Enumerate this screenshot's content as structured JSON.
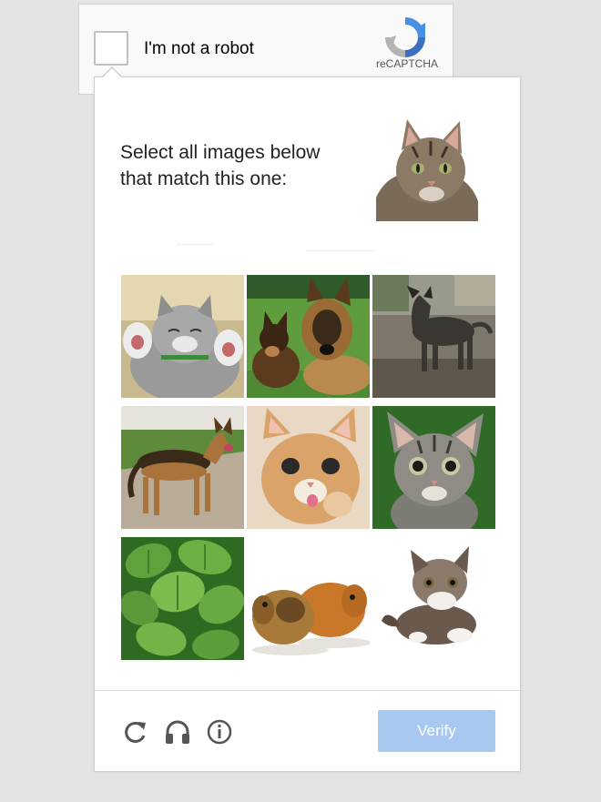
{
  "anchor": {
    "checkbox_label": "I'm not a robot",
    "brand": "reCAPTCHA",
    "checked": false
  },
  "challenge": {
    "prompt": "Select all images below that match this one:",
    "sample": {
      "subject": "tabby cat"
    },
    "tiles": [
      {
        "subject": "kitten lying on its back",
        "selected": false
      },
      {
        "subject": "two german shepherd dogs",
        "selected": false
      },
      {
        "subject": "dark dog on dirt",
        "selected": false
      },
      {
        "subject": "german shepherd standing on road",
        "selected": false
      },
      {
        "subject": "orange kitten",
        "selected": false
      },
      {
        "subject": "grey tabby kitten",
        "selected": false
      },
      {
        "subject": "green leaves",
        "selected": false
      },
      {
        "subject": "two guinea pigs",
        "selected": false
      },
      {
        "subject": "fluffy kitten",
        "selected": false
      }
    ]
  },
  "footer": {
    "reload_icon": "reload-icon",
    "audio_icon": "headphones-icon",
    "info_icon": "info-icon",
    "verify_label": "Verify"
  },
  "colors": {
    "verify_button": "#a8c8ef",
    "logo_blue": "#4a90e2",
    "logo_grey": "#b4b4b4",
    "icon_grey": "#555555"
  }
}
